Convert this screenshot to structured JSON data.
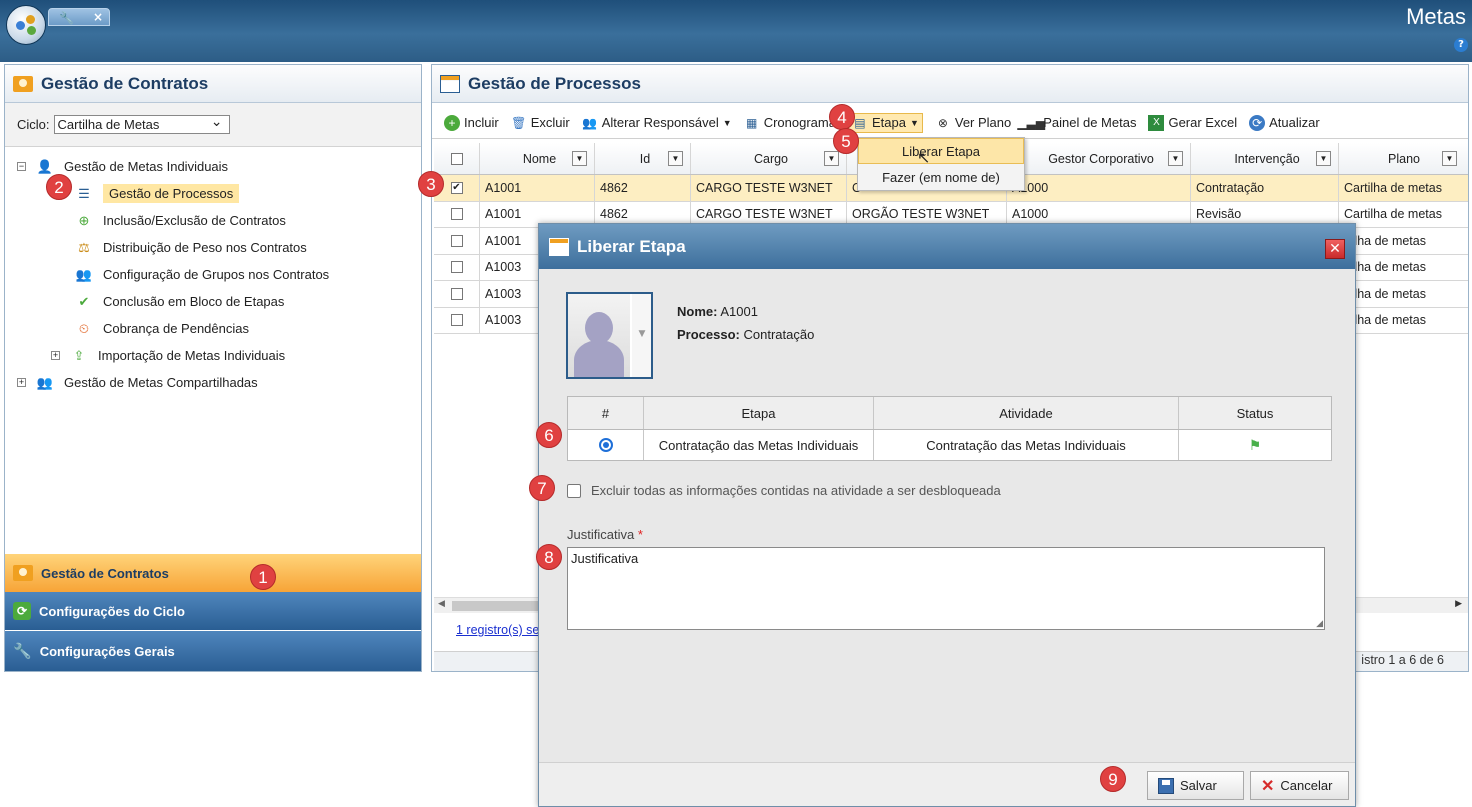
{
  "app": {
    "title": "Metas",
    "help": "?"
  },
  "left_panel": {
    "title": "Gestão de Contratos",
    "cycle_label": "Ciclo:",
    "cycle_value": "Cartilha de Metas",
    "tree": [
      {
        "label": "Gestão de Metas Individuais",
        "expander": "−"
      },
      {
        "label": "Gestão de Processos"
      },
      {
        "label": "Inclusão/Exclusão de Contratos"
      },
      {
        "label": "Distribuição de Peso nos Contratos"
      },
      {
        "label": "Configuração de Grupos nos Contratos"
      },
      {
        "label": "Conclusão em Bloco de Etapas"
      },
      {
        "label": "Cobrança de Pendências"
      },
      {
        "label": "Importação de Metas Individuais",
        "expander": "+"
      },
      {
        "label": "Gestão de Metas Compartilhadas",
        "expander": "+"
      }
    ],
    "accordion": [
      "Gestão de Contratos",
      "Configurações do Ciclo",
      "Configurações Gerais"
    ]
  },
  "right_panel": {
    "title": "Gestão de Processos",
    "toolbar": [
      {
        "label": "Incluir",
        "icon": "plus-circle-icon"
      },
      {
        "label": "Excluir",
        "icon": "trash-icon"
      },
      {
        "label": "Alterar Responsável",
        "icon": "users-icon"
      },
      {
        "label": "Cronograma",
        "icon": "calendar-icon"
      },
      {
        "label": "Etapa",
        "icon": "stage-icon"
      },
      {
        "label": "Ver Plano",
        "icon": "binoculars-icon"
      },
      {
        "label": "Painel de Metas",
        "icon": "chart-icon"
      },
      {
        "label": "Gerar Excel",
        "icon": "excel-icon"
      },
      {
        "label": "Atualizar",
        "icon": "refresh-icon"
      }
    ],
    "columns": [
      "Nome",
      "Id",
      "Cargo",
      "",
      "Gestor Corporativo",
      "Intervenção",
      "Plano"
    ],
    "rows": [
      {
        "checked": "✔",
        "nome": "A1001",
        "id": "4862",
        "cargo": "CARGO TESTE W3NET",
        "orgao": "O",
        "gestor": "A1000",
        "intervencao": "Contratação",
        "plano": "Cartilha de metas"
      },
      {
        "checked": "",
        "nome": "A1001",
        "id": "4862",
        "cargo": "CARGO TESTE W3NET",
        "orgao": "ORGÃO TESTE W3NET",
        "gestor": "A1000",
        "intervencao": "Revisão",
        "plano": "Cartilha de metas"
      },
      {
        "checked": "",
        "nome": "A1001",
        "plano": "rtilha de metas"
      },
      {
        "checked": "",
        "nome": "A1003",
        "plano": "rtilha de metas"
      },
      {
        "checked": "",
        "nome": "A1003",
        "plano": "rtilha de metas"
      },
      {
        "checked": "",
        "nome": "A1003",
        "plano": "rtilha de metas"
      }
    ],
    "pager_link": "1 registro(s) se",
    "pager_status": "istro 1 a 6 de 6"
  },
  "dropdown": {
    "items": [
      "Liberar Etapa",
      "Fazer (em nome de)"
    ]
  },
  "modal": {
    "title": "Liberar Etapa",
    "close": "✕",
    "nome_label": "Nome:",
    "nome_value": "A1001",
    "processo_label": "Processo:",
    "processo_value": "Contratação",
    "table_headers": [
      "#",
      "Etapa",
      "Atividade",
      "Status"
    ],
    "table_row": {
      "etapa": "Contratação das Metas Individuais",
      "atividade": "Contratação das Metas Individuais"
    },
    "checkbox_label": "Excluir todas as informações contidas na atividade a ser desbloqueada",
    "justificativa_label": "Justificativa",
    "required_mark": "*",
    "justificativa_value": "Justificativa",
    "save_label": "Salvar",
    "cancel_label": "Cancelar"
  },
  "callouts": [
    "1",
    "2",
    "3",
    "4",
    "5",
    "6",
    "7",
    "8",
    "9"
  ],
  "colors": {
    "callout": "#e04141",
    "accent": "#2a5e93",
    "highlight": "#fdeec2"
  }
}
